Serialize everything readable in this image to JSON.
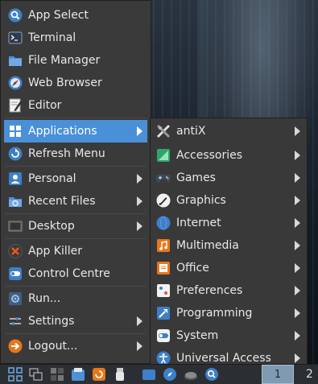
{
  "main_menu": {
    "items": [
      {
        "label": "App Select"
      },
      {
        "label": "Terminal"
      },
      {
        "label": "File Manager"
      },
      {
        "label": "Web Browser"
      },
      {
        "label": "Editor"
      },
      {
        "label": "Applications"
      },
      {
        "label": "Refresh Menu"
      },
      {
        "label": "Personal"
      },
      {
        "label": "Recent Files"
      },
      {
        "label": "Desktop"
      },
      {
        "label": "App Killer"
      },
      {
        "label": "Control Centre"
      },
      {
        "label": "Run..."
      },
      {
        "label": "Settings"
      },
      {
        "label": "Logout..."
      }
    ]
  },
  "applications_submenu": {
    "items": [
      {
        "label": "antiX"
      },
      {
        "label": "Accessories"
      },
      {
        "label": "Games"
      },
      {
        "label": "Graphics"
      },
      {
        "label": "Internet"
      },
      {
        "label": "Multimedia"
      },
      {
        "label": "Office"
      },
      {
        "label": "Preferences"
      },
      {
        "label": "Programming"
      },
      {
        "label": "System"
      },
      {
        "label": "Universal Access"
      }
    ]
  },
  "taskbar": {
    "workspace_1": "1",
    "workspace_2": "2"
  },
  "colors": {
    "menu_bg": "#3a3a3a",
    "highlight": "#4a90d9",
    "taskbar_bg": "#2b2f34"
  }
}
